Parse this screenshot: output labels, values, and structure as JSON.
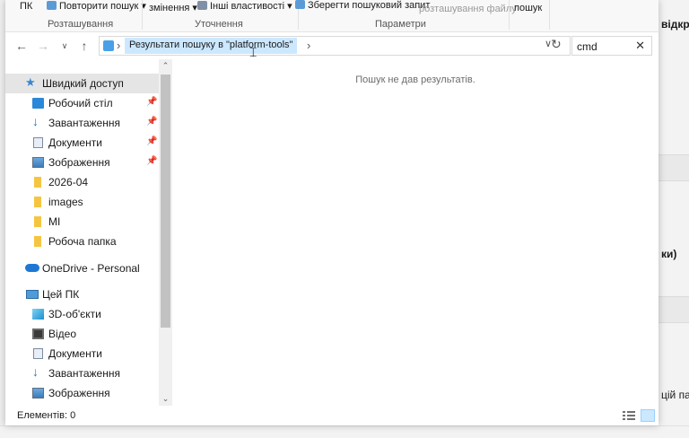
{
  "ribbon": {
    "pk_label": "ПК",
    "repeat_search": "Повторити пошук",
    "changed": "змінення",
    "other_props": "Інші властивості",
    "save_search": "Зберегти пошуковий запит",
    "file_location": "розташування файлу",
    "search_label": "пошук",
    "group_location": "Розташування",
    "group_refine": "Уточнення",
    "group_options": "Параметри"
  },
  "address": {
    "crumb": "Результати пошуку в \"platform-tools\"",
    "search_value": "cmd"
  },
  "nav": {
    "quick_access": "Швидкий доступ",
    "quick_items": [
      {
        "label": "Робочий стіл",
        "icon": "desktop-icon",
        "pinned": true
      },
      {
        "label": "Завантаження",
        "icon": "download-icon",
        "pinned": true
      },
      {
        "label": "Документи",
        "icon": "documents-icon",
        "pinned": true
      },
      {
        "label": "Зображення",
        "icon": "pictures-icon",
        "pinned": true
      },
      {
        "label": "2026-04",
        "icon": "folder-icon",
        "pinned": false
      },
      {
        "label": "images",
        "icon": "folder-icon",
        "pinned": false
      },
      {
        "label": "MI",
        "icon": "folder-icon",
        "pinned": false
      },
      {
        "label": "Робоча папка",
        "icon": "folder-icon",
        "pinned": false
      }
    ],
    "onedrive": "OneDrive - Personal",
    "this_pc": "Цей ПК",
    "pc_items": [
      {
        "label": "3D-об'єкти",
        "icon": "3d-objects-icon"
      },
      {
        "label": "Відео",
        "icon": "video-icon"
      },
      {
        "label": "Документи",
        "icon": "documents-icon"
      },
      {
        "label": "Завантаження",
        "icon": "download-icon"
      },
      {
        "label": "Зображення",
        "icon": "pictures-icon"
      }
    ]
  },
  "content": {
    "empty_message": "Пошук не дав результатів."
  },
  "status": {
    "items_count": "Елементів: 0"
  },
  "background_window": {
    "text1": "відкр",
    "text2": "ки)",
    "text3": "цій па"
  }
}
